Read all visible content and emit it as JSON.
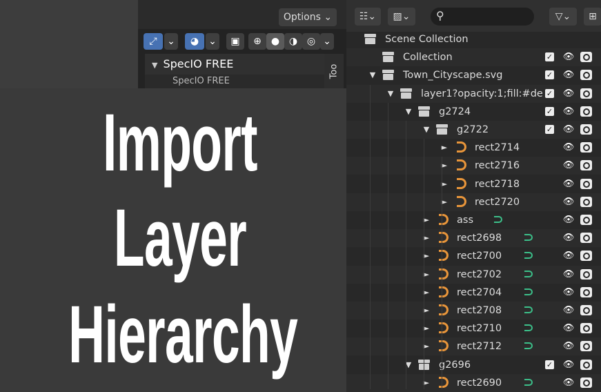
{
  "viewport": {
    "options_label": "Options ⌄",
    "panel_title": "SpecIO FREE",
    "panel_sub": "SpecIO FREE",
    "tool_tab": "Too"
  },
  "overlay": {
    "line1": "Import",
    "line2": "Layer",
    "line3": "Hierarchy"
  },
  "outliner": {
    "rows": [
      {
        "label": "Scene Collection",
        "type": "collection",
        "level": 0,
        "arrow": "",
        "check": false,
        "eye": false
      },
      {
        "label": "Collection",
        "type": "collection",
        "level": 1,
        "arrow": "",
        "check": true,
        "eye": true
      },
      {
        "label": "Town_Cityscape.svg",
        "type": "collection",
        "level": 1,
        "arrow": "▼",
        "check": true,
        "eye": true
      },
      {
        "label": "layer1?opacity:1;fill:#de",
        "type": "collection",
        "level": 2,
        "arrow": "▼",
        "check": true,
        "eye": true
      },
      {
        "label": "g2724",
        "type": "collection",
        "level": 3,
        "arrow": "▼",
        "check": true,
        "eye": true
      },
      {
        "label": "g2722",
        "type": "collection",
        "level": 4,
        "arrow": "▼",
        "check": true,
        "eye": true
      },
      {
        "label": "rect2714",
        "type": "curve",
        "level": 5,
        "arrow": "►",
        "check": false,
        "eye": true
      },
      {
        "label": "rect2716",
        "type": "curve",
        "level": 5,
        "arrow": "►",
        "check": false,
        "eye": true
      },
      {
        "label": "rect2718",
        "type": "curve",
        "level": 5,
        "arrow": "►",
        "check": false,
        "eye": true
      },
      {
        "label": "rect2720",
        "type": "curve",
        "level": 5,
        "arrow": "►",
        "check": false,
        "eye": true
      },
      {
        "label": "ass",
        "type": "curve",
        "level": 4,
        "arrow": "►",
        "check": false,
        "eye": true,
        "mod": true
      },
      {
        "label": "rect2698",
        "type": "curve",
        "level": 4,
        "arrow": "►",
        "check": false,
        "eye": true,
        "mod": true
      },
      {
        "label": "rect2700",
        "type": "curve",
        "level": 4,
        "arrow": "►",
        "check": false,
        "eye": true,
        "mod": true
      },
      {
        "label": "rect2702",
        "type": "curve",
        "level": 4,
        "arrow": "►",
        "check": false,
        "eye": true,
        "mod": true
      },
      {
        "label": "rect2704",
        "type": "curve",
        "level": 4,
        "arrow": "►",
        "check": false,
        "eye": true,
        "mod": true
      },
      {
        "label": "rect2708",
        "type": "curve",
        "level": 4,
        "arrow": "►",
        "check": false,
        "eye": true,
        "mod": true
      },
      {
        "label": "rect2710",
        "type": "curve",
        "level": 4,
        "arrow": "►",
        "check": false,
        "eye": true,
        "mod": true
      },
      {
        "label": "rect2712",
        "type": "curve",
        "level": 4,
        "arrow": "►",
        "check": false,
        "eye": true,
        "mod": true
      },
      {
        "label": "g2696",
        "type": "collection",
        "level": 3,
        "arrow": "▼",
        "check": true,
        "eye": true
      },
      {
        "label": "rect2690",
        "type": "curve",
        "level": 4,
        "arrow": "►",
        "check": false,
        "eye": true,
        "mod": true
      }
    ]
  },
  "colors": {
    "accent_blue": "#4772b3",
    "curve_orange": "#e8953a",
    "modifier_green": "#3cc08a"
  }
}
